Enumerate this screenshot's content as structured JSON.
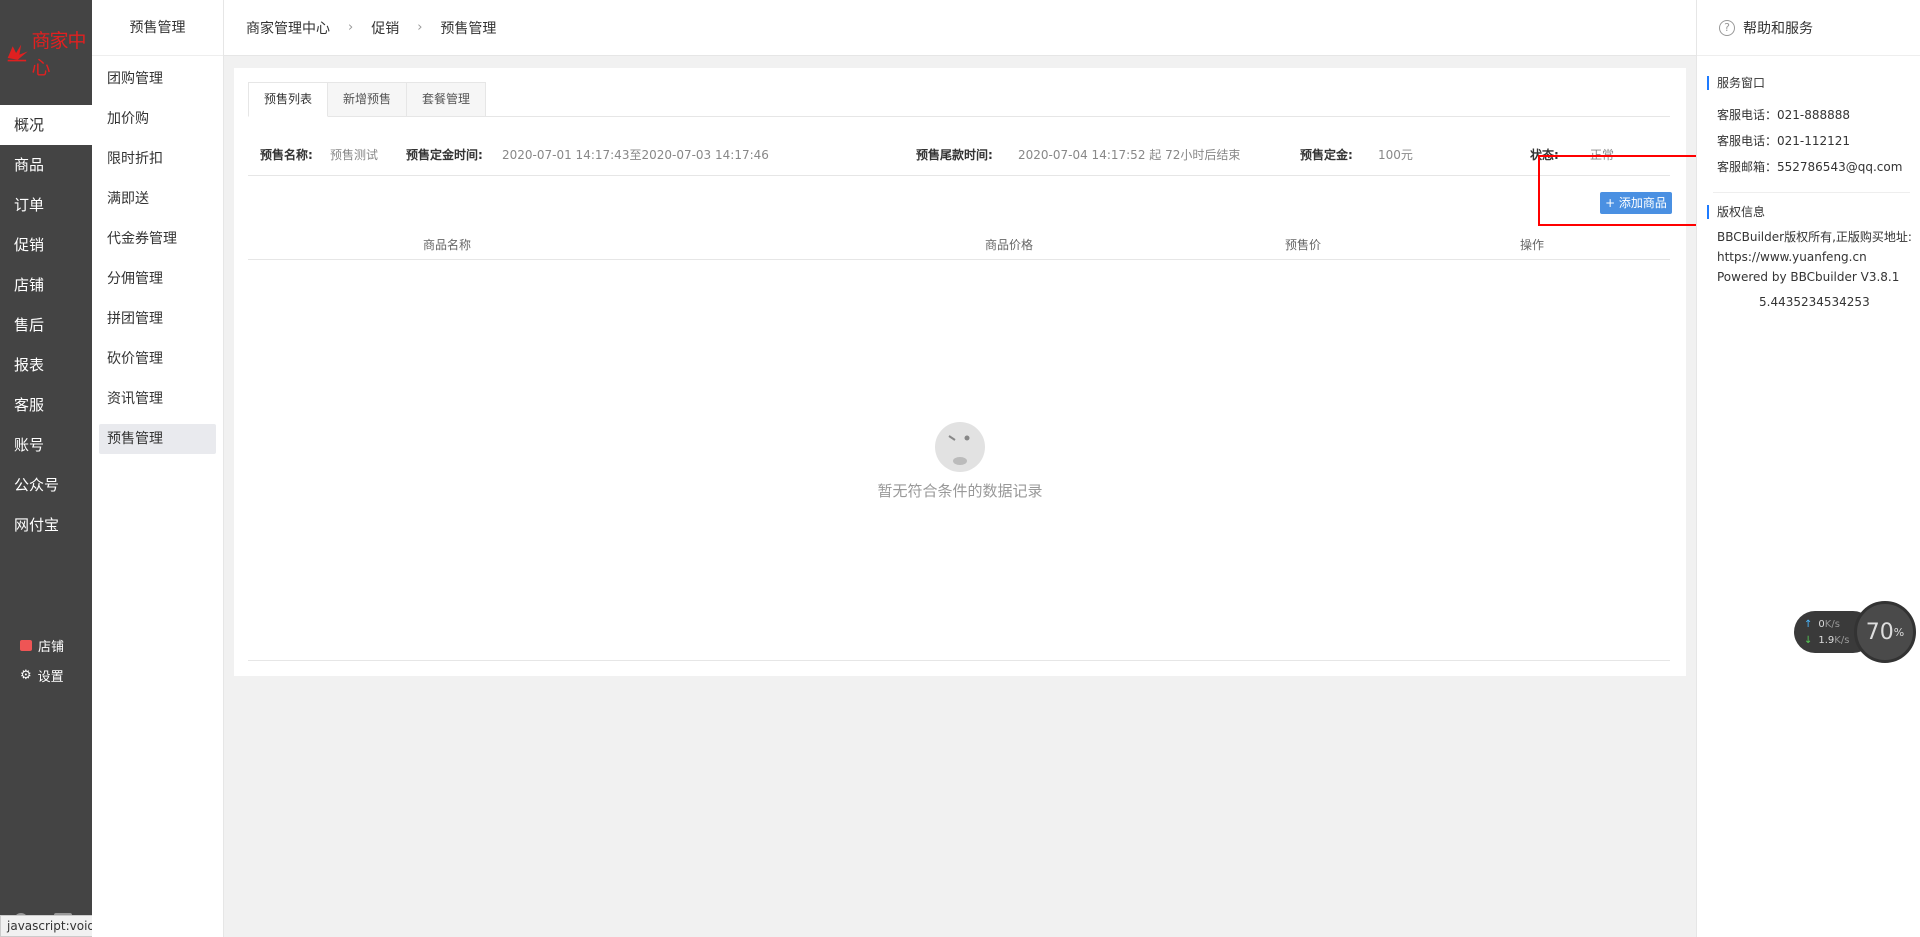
{
  "app": {
    "logo_text": "商家中心"
  },
  "main_nav": [
    {
      "label": "概况",
      "active": true
    },
    {
      "label": "商品",
      "active": false
    },
    {
      "label": "订单",
      "active": false
    },
    {
      "label": "促销",
      "active": false
    },
    {
      "label": "店铺",
      "active": false
    },
    {
      "label": "售后",
      "active": false
    },
    {
      "label": "报表",
      "active": false
    },
    {
      "label": "客服",
      "active": false
    },
    {
      "label": "账号",
      "active": false
    },
    {
      "label": "公众号",
      "active": false
    },
    {
      "label": "网付宝",
      "active": false
    }
  ],
  "nav_bottom": {
    "shop": "店铺",
    "settings": "设置"
  },
  "subnav": {
    "title": "预售管理",
    "items": [
      {
        "label": "团购管理"
      },
      {
        "label": "加价购"
      },
      {
        "label": "限时折扣"
      },
      {
        "label": "满即送"
      },
      {
        "label": "代金券管理"
      },
      {
        "label": "分佣管理"
      },
      {
        "label": "拼团管理"
      },
      {
        "label": "砍价管理"
      },
      {
        "label": "资讯管理"
      },
      {
        "label": "预售管理"
      }
    ]
  },
  "breadcrumb": [
    "商家管理中心",
    "促销",
    "预售管理"
  ],
  "breadcrumb_sep": "›",
  "tabs": [
    "预售列表",
    "新增预售",
    "套餐管理"
  ],
  "info": {
    "name_key": "预售名称:",
    "name_val": "预售测试",
    "deposit_time_key": "预售定金时间:",
    "deposit_time_val": "2020-07-01 14:17:43至2020-07-03 14:17:46",
    "final_time_key": "预售尾款时间:",
    "final_time_val": "2020-07-04 14:17:52 起 72小时后结束",
    "deposit_key": "预售定金:",
    "deposit_val": "100元",
    "status_key": "状态:",
    "status_val": "正常"
  },
  "add_button": "+ 添加商品",
  "table_headers": [
    "商品名称",
    "商品价格",
    "预售价",
    "操作"
  ],
  "empty_text": "暂无符合条件的数据记录",
  "right_panel": {
    "title": "帮助和服务",
    "service_title": "服务窗口",
    "service_lines": [
      "客服电话：021-888888",
      "客服电话：021-112121",
      "客服邮箱：552786543@qq.com"
    ],
    "copyright_title": "版权信息",
    "copyright_lines": [
      "BBCBuilder版权所有,正版购买地址:",
      "https://www.yuanfeng.cn",
      "Powered by BBCbuilder V3.8.1"
    ],
    "number": "5.4435234534253"
  },
  "speed": {
    "up": "0",
    "up_unit": "K/s",
    "down": "1.9",
    "down_unit": "K/s",
    "percent": "70",
    "percent_unit": "%"
  },
  "status_url": "javascript:void(0);",
  "colors": {
    "accent": "#4a90e2",
    "nav_bg": "#444444",
    "logo": "#e02020",
    "highlight_box": "#ff0000"
  }
}
